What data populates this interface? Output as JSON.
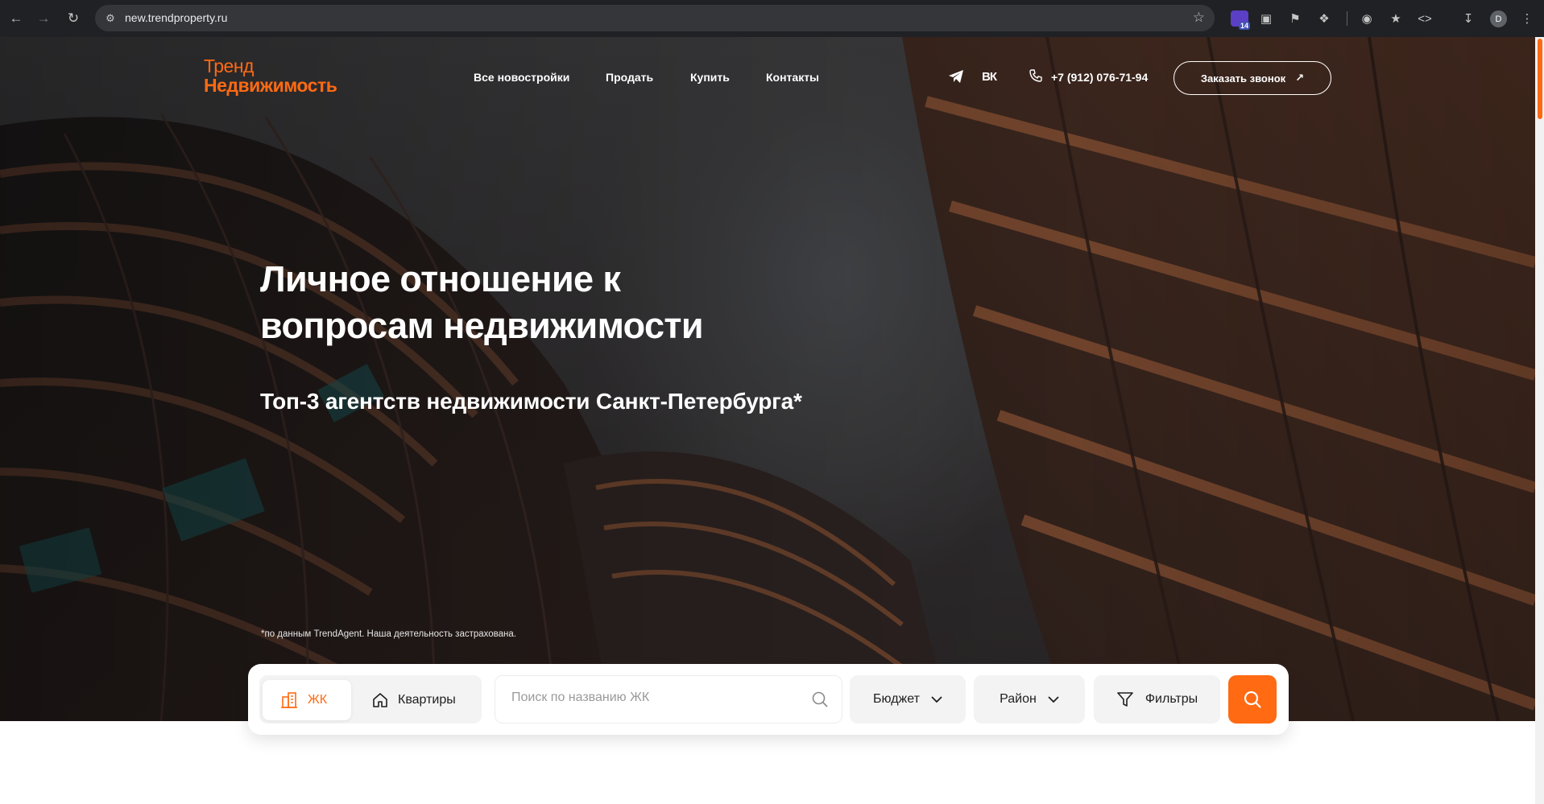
{
  "browser": {
    "url": "new.trendproperty.ru",
    "profile_initial": "D",
    "extension_badge": "14",
    "icons": [
      "back-icon",
      "forward-icon",
      "reload-icon",
      "site-settings-icon",
      "bookmark-star-icon",
      "camera-icon",
      "extensions-icon",
      "download-icon",
      "menu-icon"
    ]
  },
  "header": {
    "logo_line1": "Тренд",
    "logo_line2": "Недвижимость",
    "nav": [
      "Все новостройки",
      "Продать",
      "Купить",
      "Контакты"
    ],
    "phone": "+7 (912) 076-71-94",
    "callback_label": "Заказать звонок",
    "callback_arrow": "↗",
    "social_vk": "ВК"
  },
  "hero": {
    "headline_line1": "Личное отношение к",
    "headline_line2": "вопросам недвижимости",
    "subheadline": "Топ-3 агентств недвижимости Санкт-Петербурга*",
    "footnote": "*по данным TrendAgent. Наша деятельность застрахована."
  },
  "search": {
    "tab_complex": "ЖК",
    "tab_apartments": "Квартиры",
    "active_tab": "ЖК",
    "placeholder": "Поиск по названию ЖК",
    "budget_label": "Бюджет",
    "district_label": "Район",
    "filters_label": "Фильтры"
  },
  "colors": {
    "accent": "#ff6a13",
    "chrome_bg": "#202124",
    "panel_bg": "#f3f3f3"
  }
}
